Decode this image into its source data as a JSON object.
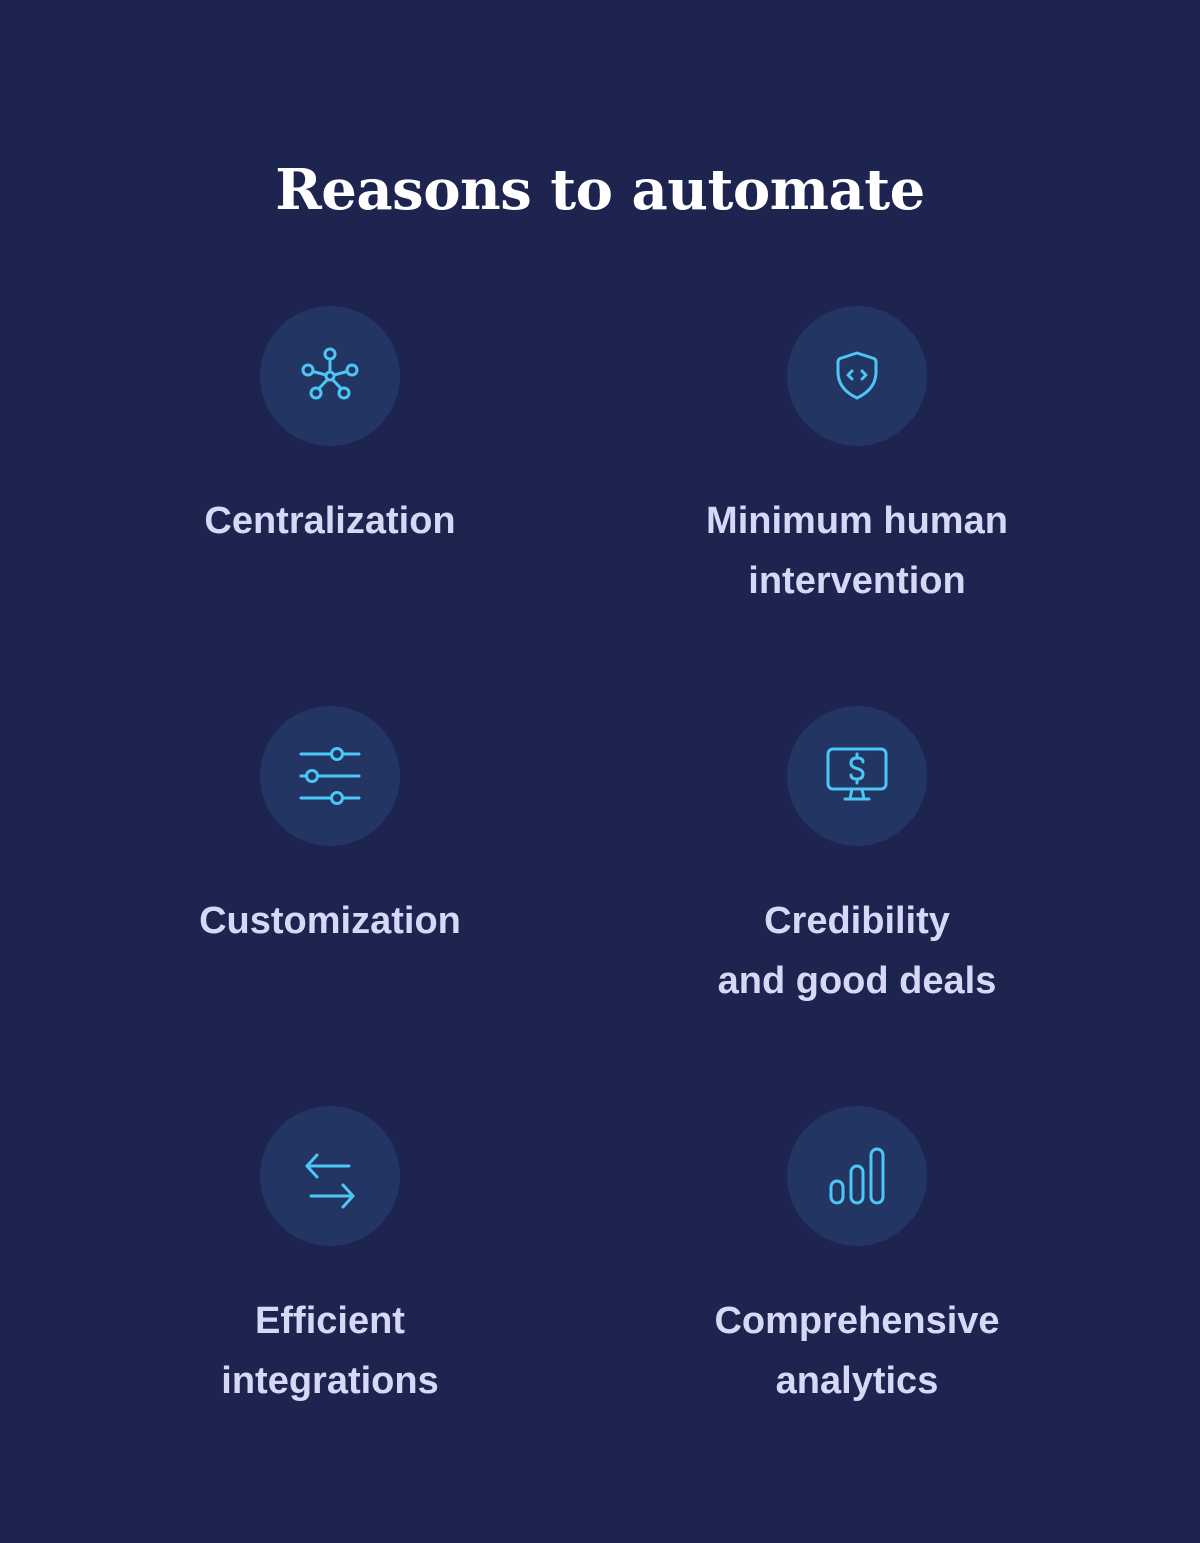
{
  "title": "Reasons to automate",
  "colors": {
    "background": "#1e2450",
    "circle": "#233562",
    "icon": "#4cc6f5",
    "label": "#d5d9f5",
    "title": "#ffffff"
  },
  "items": [
    {
      "icon": "network-hub-icon",
      "label": "Centralization"
    },
    {
      "icon": "shield-code-icon",
      "label": "Minimum human\nintervention"
    },
    {
      "icon": "sliders-icon",
      "label": "Customization"
    },
    {
      "icon": "monitor-dollar-icon",
      "label": "Credibility\nand good deals"
    },
    {
      "icon": "arrows-exchange-icon",
      "label": "Efficient\nintegrations"
    },
    {
      "icon": "bar-chart-icon",
      "label": "Comprehensive\nanalytics"
    }
  ]
}
